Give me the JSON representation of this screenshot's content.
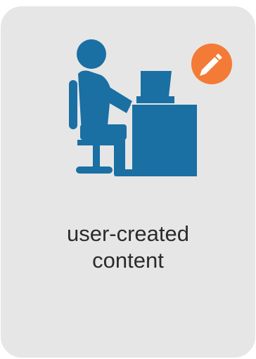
{
  "card": {
    "label_line1": "user-created",
    "label_line2": "content",
    "icon": "person-at-desk-icon",
    "badge_icon": "pencil-icon",
    "colors": {
      "background": "#e6e6e6",
      "figure": "#1a6fa3",
      "badge": "#f37b35",
      "text": "#2b2b2b"
    }
  }
}
